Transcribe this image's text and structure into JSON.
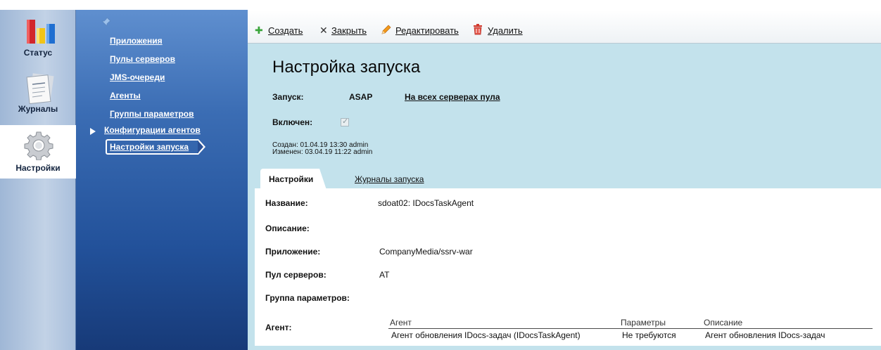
{
  "rail": {
    "items": [
      {
        "label": "Статус",
        "icon": "bar-chart-icon"
      },
      {
        "label": "Журналы",
        "icon": "document-icon"
      },
      {
        "label": "Настройки",
        "icon": "gear-icon"
      }
    ]
  },
  "nav": {
    "items": [
      {
        "label": "Приложения"
      },
      {
        "label": "Пулы серверов"
      },
      {
        "label": "JMS-очереди"
      },
      {
        "label": "Агенты"
      },
      {
        "label": "Группы параметров"
      },
      {
        "label": "Конфигурации агентов"
      }
    ],
    "active": "Настройки запуска"
  },
  "toolbar": {
    "create": "Создать",
    "close": "Закрыть",
    "edit": "Редактировать",
    "delete": "Удалить"
  },
  "page": {
    "title": "Настройка запуска",
    "launch_label": "Запуск:",
    "launch_value": "ASAP",
    "launch_link": "На всех серверах пула",
    "enabled_label": "Включен:",
    "enabled": true,
    "created": "Создан:   01.04.19 13:30  admin",
    "modified": "Изменен: 03.04.19 11:22  admin"
  },
  "tabs": {
    "active": "Настройки",
    "other": "Журналы запуска"
  },
  "form": {
    "name_label": "Название:",
    "name_value": "sdoat02: IDocsTaskAgent",
    "desc_label": "Описание:",
    "app_label": "Приложение:",
    "app_value": "CompanyMedia/ssrv-war",
    "pool_label": "Пул серверов:",
    "pool_value": "AT",
    "group_label": "Группа параметров:",
    "agent_label": "Агент:",
    "agent_table": {
      "columns": [
        "Агент",
        "Параметры",
        "Описание"
      ],
      "rows": [
        [
          "Агент обновления IDocs-задач (IDocsTaskAgent)",
          "Не требуются",
          "Агент обновления IDocs-задач"
        ]
      ]
    }
  }
}
